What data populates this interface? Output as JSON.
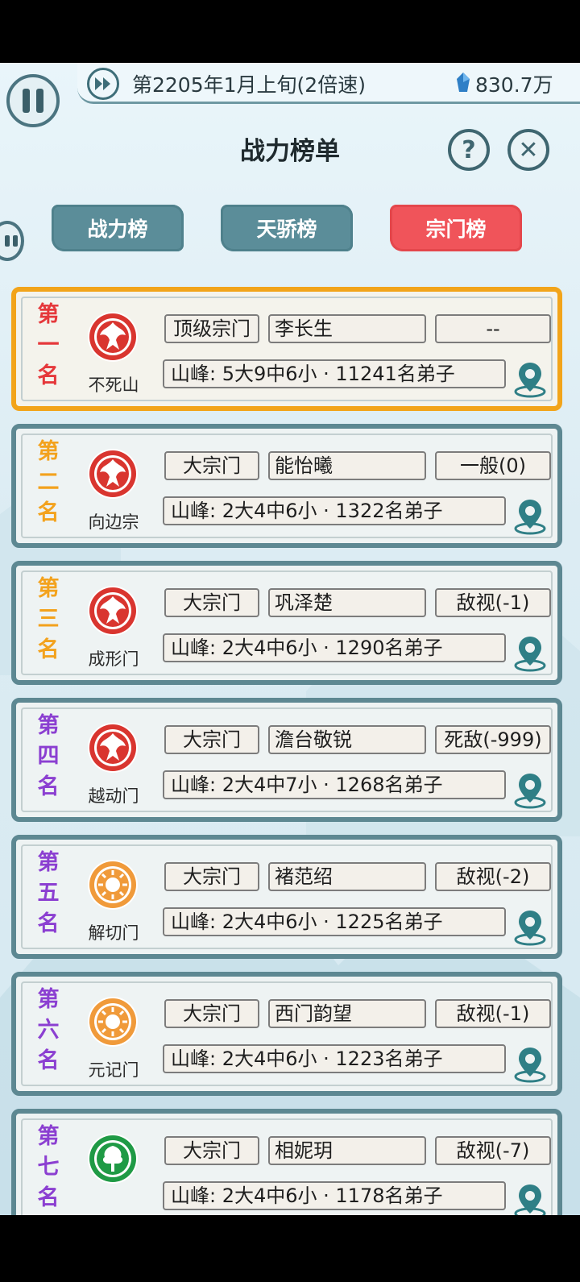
{
  "topbar": {
    "date": "第2205年1月上旬(2倍速)",
    "money": "830.7万"
  },
  "title": "战力榜单",
  "help_symbol": "?",
  "close_symbol": "✕",
  "tabs": [
    {
      "label": "战力榜",
      "active": false
    },
    {
      "label": "天骄榜",
      "active": false
    },
    {
      "label": "宗门榜",
      "active": true
    }
  ],
  "colors": {
    "tab_active": "#f0545a",
    "tab_inactive": "#5b8d99",
    "first_border": "#f2a41a",
    "card_border": "#5d8892"
  },
  "sects": [
    {
      "rank": [
        "第",
        "一",
        "名"
      ],
      "rank_color": "#e5383b",
      "emblem": "phoenix-icon",
      "name": "不死山",
      "type": "顶级宗门",
      "leader": "李长生",
      "relation": "--",
      "info": "山峰: 5大9中6小 · 11241名弟子"
    },
    {
      "rank": [
        "第",
        "二",
        "名"
      ],
      "rank_color": "#f3a21d",
      "emblem": "phoenix-icon",
      "name": "向边宗",
      "type": "大宗门",
      "leader": "能怡曦",
      "relation": "一般(0)",
      "info": "山峰: 2大4中6小 · 1322名弟子"
    },
    {
      "rank": [
        "第",
        "三",
        "名"
      ],
      "rank_color": "#f3a21d",
      "emblem": "phoenix-icon",
      "name": "成形门",
      "type": "大宗门",
      "leader": "巩泽楚",
      "relation": "敌视(-1)",
      "info": "山峰: 2大4中6小 · 1290名弟子"
    },
    {
      "rank": [
        "第",
        "四",
        "名"
      ],
      "rank_color": "#8b3fd1",
      "emblem": "phoenix-icon",
      "name": "越动门",
      "type": "大宗门",
      "leader": "澹台敬锐",
      "relation": "死敌(-999)",
      "info": "山峰: 2大4中7小 · 1268名弟子"
    },
    {
      "rank": [
        "第",
        "五",
        "名"
      ],
      "rank_color": "#8b3fd1",
      "emblem": "sun-icon",
      "name": "解切门",
      "type": "大宗门",
      "leader": "褚范绍",
      "relation": "敌视(-2)",
      "info": "山峰: 2大4中6小 · 1225名弟子"
    },
    {
      "rank": [
        "第",
        "六",
        "名"
      ],
      "rank_color": "#8b3fd1",
      "emblem": "sun-icon",
      "name": "元记门",
      "type": "大宗门",
      "leader": "西门韵望",
      "relation": "敌视(-1)",
      "info": "山峰: 2大4中6小 · 1223名弟子"
    },
    {
      "rank": [
        "第",
        "七",
        "名"
      ],
      "rank_color": "#8b3fd1",
      "emblem": "tree-icon",
      "name": "",
      "type": "大宗门",
      "leader": "相妮玥",
      "relation": "敌视(-7)",
      "info": "山峰: 2大4中6小 · 1178名弟子"
    }
  ]
}
